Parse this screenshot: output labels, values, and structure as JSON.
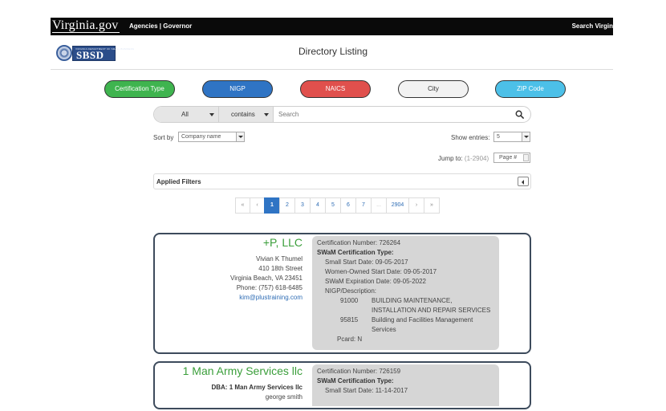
{
  "topbar": {
    "logo": "Virginia.gov",
    "links": "Agencies | Governor",
    "search": "Search Virgin"
  },
  "header": {
    "logo_small": "VIRGINIA DEPARTMENT OF SMALL BUSINESS",
    "logo_big": "SBSD",
    "title": "Directory Listing"
  },
  "filters": {
    "certification_type": "Certification Type",
    "nigp": "NIGP",
    "naics": "NAICS",
    "city": "City",
    "zip_code": "ZIP Code"
  },
  "search": {
    "scope": "All",
    "operator": "contains",
    "placeholder": "Search"
  },
  "sort": {
    "label": "Sort by",
    "value": "Company name"
  },
  "entries": {
    "label": "Show entries:",
    "value": "5"
  },
  "jump": {
    "label": "Jump to:",
    "range": "(1-2904)",
    "placeholder": "Page #"
  },
  "applied_filters": {
    "label": "Applied Filters"
  },
  "pagination": {
    "first": "«",
    "prev": "‹",
    "pages": [
      "1",
      "2",
      "3",
      "4",
      "5",
      "6",
      "7"
    ],
    "dots": "...",
    "last_page": "2904",
    "next": "›",
    "last": "»"
  },
  "results": [
    {
      "company": "+P, LLC",
      "contact_name": "Vivian K Thumel",
      "address1": "410 18th Street",
      "address2": "Virginia Beach, VA 23451",
      "phone": "Phone: (757) 618-6485",
      "email": "kim@plustraining.com",
      "cert_number": "Certification Number: 726264",
      "cert_type_label": "SWaM Certification Type:",
      "small_start": "Small Start Date: 09-05-2017",
      "women_start": "Women-Owned Start Date: 09-05-2017",
      "swam_expiration": "SWaM Expiration Date: 09-05-2022",
      "nigp_label": "NIGP/Description:",
      "nigp": [
        {
          "code": "91000",
          "desc1": "BUILDING MAINTENANCE,",
          "desc2": "INSTALLATION AND REPAIR SERVICES"
        },
        {
          "code": "95815",
          "desc1": "Building and Facilities Management",
          "desc2": "Services"
        }
      ],
      "pcard": "Pcard: N"
    },
    {
      "company": "1 Man Army Services llc",
      "dba": "DBA: 1 Man Army Services llc",
      "contact_name": "george smith",
      "cert_number": "Certification Number: 726159",
      "cert_type_label": "SWaM Certification Type:",
      "small_start": "Small Start Date: 11-14-2017"
    }
  ]
}
